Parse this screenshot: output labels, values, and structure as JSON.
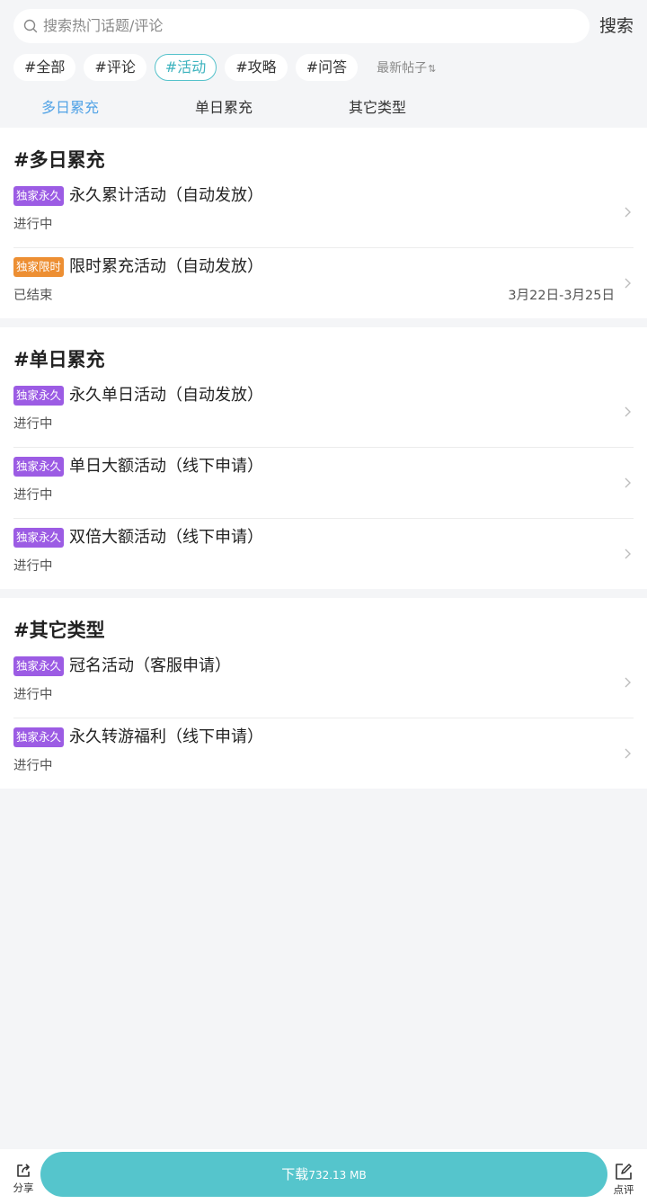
{
  "search": {
    "placeholder": "搜索热门话题/评论",
    "button": "搜索"
  },
  "chips": [
    {
      "label": "#全部",
      "active": false
    },
    {
      "label": "#评论",
      "active": false
    },
    {
      "label": "#活动",
      "active": true
    },
    {
      "label": "#攻略",
      "active": false
    },
    {
      "label": "#问答",
      "active": false
    }
  ],
  "sort": {
    "label": "最新帖子",
    "icon": "sort-arrows-icon"
  },
  "tabs": [
    {
      "label": "多日累充",
      "active": true
    },
    {
      "label": "单日累充",
      "active": false
    },
    {
      "label": "其它类型",
      "active": false
    }
  ],
  "sections": [
    {
      "title": "#多日累充",
      "items": [
        {
          "badge": "独家永久",
          "badge_color": "#9c5ce4",
          "title": "永久累计活动（自动发放）",
          "status": "进行中",
          "date": ""
        },
        {
          "badge": "独家限时",
          "badge_color": "#ed8f33",
          "title": "限时累充活动（自动发放）",
          "status": "已结束",
          "date": "3月22日-3月25日"
        }
      ]
    },
    {
      "title": "#单日累充",
      "items": [
        {
          "badge": "独家永久",
          "badge_color": "#9c5ce4",
          "title": "永久单日活动（自动发放）",
          "status": "进行中",
          "date": ""
        },
        {
          "badge": "独家永久",
          "badge_color": "#9c5ce4",
          "title": "单日大额活动（线下申请）",
          "status": "进行中",
          "date": ""
        },
        {
          "badge": "独家永久",
          "badge_color": "#9c5ce4",
          "title": "双倍大额活动（线下申请）",
          "status": "进行中",
          "date": ""
        }
      ]
    },
    {
      "title": "#其它类型",
      "items": [
        {
          "badge": "独家永久",
          "badge_color": "#9c5ce4",
          "title": "冠名活动（客服申请）",
          "status": "进行中",
          "date": ""
        },
        {
          "badge": "独家永久",
          "badge_color": "#9c5ce4",
          "title": "永久转游福利（线下申请）",
          "status": "进行中",
          "date": ""
        }
      ]
    }
  ],
  "bottom": {
    "share_label": "分享",
    "download_label": "下载",
    "download_size": "732.13 MB",
    "review_label": "点评"
  },
  "colors": {
    "accent": "#55c5cc",
    "tab_active": "#52a3e6",
    "badge_purple": "#9c5ce4",
    "badge_orange": "#ed8f33"
  }
}
